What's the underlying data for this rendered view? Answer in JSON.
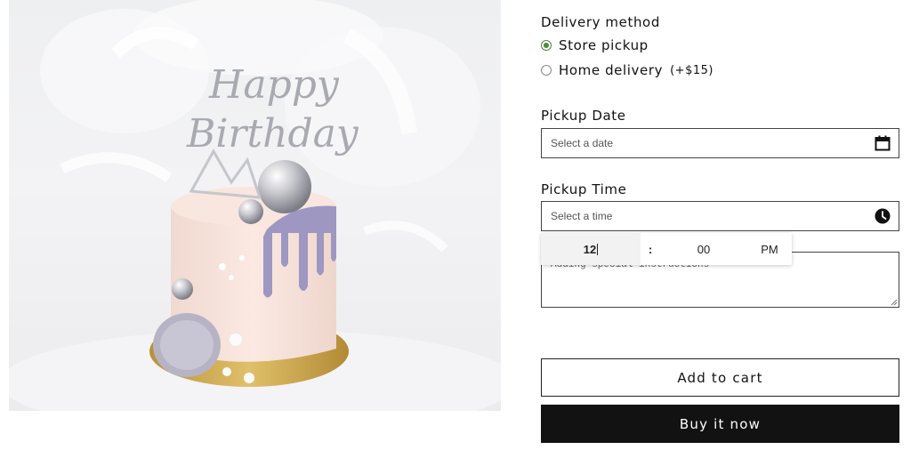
{
  "product": {
    "image_alt": "Birthday cake with silver spheres, lavender drip and macaron",
    "topper_line1": "Happy",
    "topper_line2": "Birthday"
  },
  "delivery": {
    "label": "Delivery method",
    "options": [
      {
        "label": "Store pickup",
        "extra": "",
        "selected": true
      },
      {
        "label": "Home delivery",
        "extra": "(+$15)",
        "selected": false
      }
    ]
  },
  "pickup_date": {
    "label": "Pickup Date",
    "placeholder": "Select a date",
    "icon": "calendar-icon"
  },
  "pickup_time": {
    "label": "Pickup Time",
    "placeholder": "Select a time",
    "icon": "clock-icon"
  },
  "time_picker": {
    "hour": "12",
    "separator": ":",
    "minute": "00",
    "period": "PM"
  },
  "instructions": {
    "placeholder": "Adding special instructions"
  },
  "actions": {
    "add_to_cart": "Add to cart",
    "buy_now": "Buy it now"
  },
  "colors": {
    "radio_selected": "#4f8a3b",
    "button_dark": "#121212",
    "drip": "#9d97c2"
  }
}
